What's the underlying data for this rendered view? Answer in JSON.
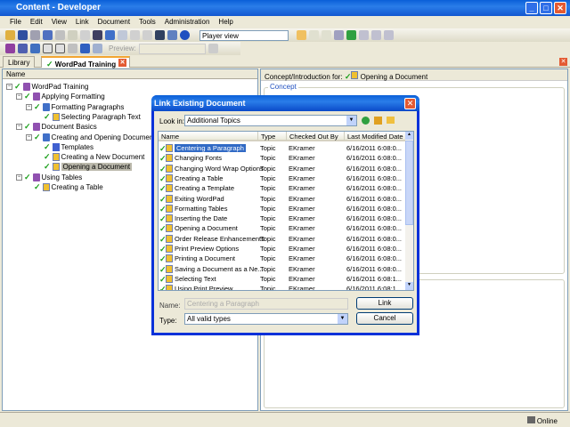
{
  "window": {
    "title": "Content - Developer"
  },
  "menu": [
    "File",
    "Edit",
    "View",
    "Link",
    "Document",
    "Tools",
    "Administration",
    "Help"
  ],
  "toolbar": {
    "view_select": "Player view",
    "preview_label": "Preview:"
  },
  "tabs": [
    {
      "label": "Library"
    },
    {
      "label": "WordPad Training"
    }
  ],
  "left": {
    "column_header": "Name",
    "tree": [
      {
        "label": "WordPad Training",
        "level": 0,
        "icon": "book",
        "toggle": "-"
      },
      {
        "label": "Applying Formatting",
        "level": 1,
        "icon": "book",
        "toggle": "-"
      },
      {
        "label": "Formatting Paragraphs",
        "level": 2,
        "icon": "book-blue",
        "toggle": "-"
      },
      {
        "label": "Selecting Paragraph Text",
        "level": 3,
        "icon": "topic"
      },
      {
        "label": "Document Basics",
        "level": 1,
        "icon": "book",
        "toggle": "-"
      },
      {
        "label": "Creating and Opening Documents",
        "level": 2,
        "icon": "book-blue",
        "toggle": "-"
      },
      {
        "label": "Templates",
        "level": 3,
        "icon": "doc"
      },
      {
        "label": "Creating a New Document",
        "level": 3,
        "icon": "topic"
      },
      {
        "label": "Opening a Document",
        "level": 3,
        "icon": "topic",
        "selected": true
      },
      {
        "label": "Using Tables",
        "level": 1,
        "icon": "book",
        "toggle": "-"
      },
      {
        "label": "Creating a Table",
        "level": 2,
        "icon": "topic"
      }
    ]
  },
  "right": {
    "concept_for_label": "Concept/Introduction for:",
    "concept_doc": "Opening a Document",
    "group_label": "Concept"
  },
  "status": {
    "online": "Online"
  },
  "dialog": {
    "title": "Link Existing Document",
    "look_in_label": "Look in:",
    "look_in_value": "Additional Topics",
    "columns": [
      "Name",
      "Type",
      "Checked Out By",
      "Last Modified Date"
    ],
    "rows": [
      {
        "name": "Centering a Paragraph",
        "type": "Topic",
        "by": "EKramer",
        "date": "6/16/2011 6:08:0..."
      },
      {
        "name": "Changing Fonts",
        "type": "Topic",
        "by": "EKramer",
        "date": "6/16/2011 6:08:0..."
      },
      {
        "name": "Changing Word Wrap Options",
        "type": "Topic",
        "by": "EKramer",
        "date": "6/16/2011 6:08:0..."
      },
      {
        "name": "Creating a Table",
        "type": "Topic",
        "by": "EKramer",
        "date": "6/16/2011 6:08:0..."
      },
      {
        "name": "Creating a Template",
        "type": "Topic",
        "by": "EKramer",
        "date": "6/16/2011 6:08:0..."
      },
      {
        "name": "Exiting WordPad",
        "type": "Topic",
        "by": "EKramer",
        "date": "6/16/2011 6:08:0..."
      },
      {
        "name": "Formatting Tables",
        "type": "Topic",
        "by": "EKramer",
        "date": "6/16/2011 6:08:0..."
      },
      {
        "name": "Inserting the Date",
        "type": "Topic",
        "by": "EKramer",
        "date": "6/16/2011 6:08:0..."
      },
      {
        "name": "Opening a Document",
        "type": "Topic",
        "by": "EKramer",
        "date": "6/16/2011 6:08:0..."
      },
      {
        "name": "Order Release Enhancements",
        "type": "Topic",
        "by": "EKramer",
        "date": "6/16/2011 6:08:0..."
      },
      {
        "name": "Print Preview Options",
        "type": "Topic",
        "by": "EKramer",
        "date": "6/16/2011 6:08:0..."
      },
      {
        "name": "Printing a Document",
        "type": "Topic",
        "by": "EKramer",
        "date": "6/16/2011 6:08:0..."
      },
      {
        "name": "Saving a Document as a Ne...",
        "type": "Topic",
        "by": "EKramer",
        "date": "6/16/2011 6:08:0..."
      },
      {
        "name": "Selecting Text",
        "type": "Topic",
        "by": "EKramer",
        "date": "6/16/2011 6:08:1..."
      },
      {
        "name": "Using Print Preview",
        "type": "Topic",
        "by": "EKramer",
        "date": "6/16/2011 6:08:1..."
      }
    ],
    "name_label": "Name:",
    "name_value": "Centering a Paragraph",
    "type_label": "Type:",
    "type_value": "All valid types",
    "link_button": "Link",
    "cancel_button": "Cancel"
  }
}
